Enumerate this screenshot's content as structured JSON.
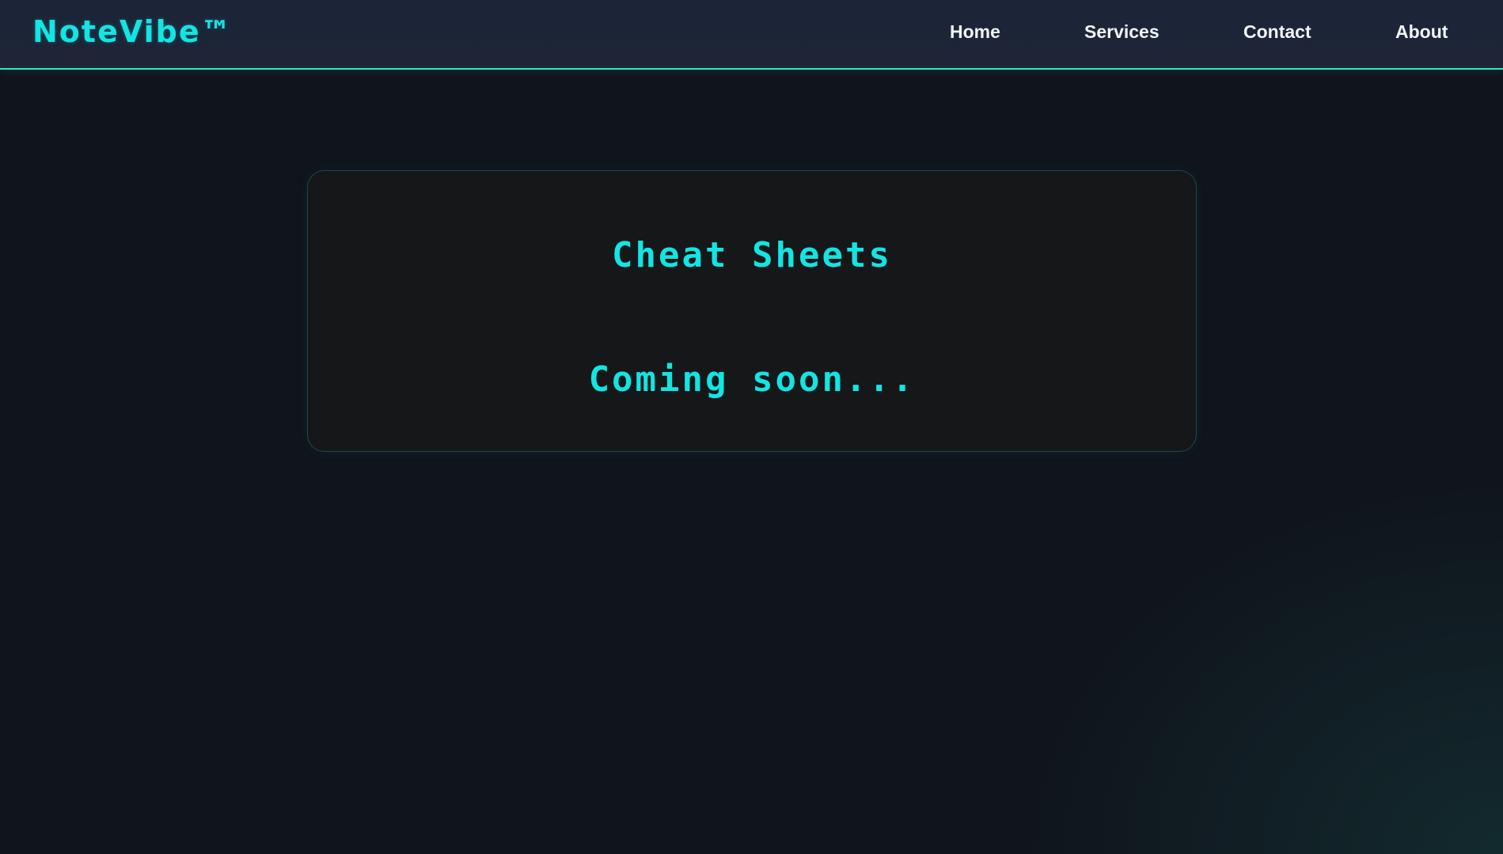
{
  "header": {
    "brand": "NoteVibe™",
    "nav": {
      "home": "Home",
      "services": "Services",
      "contact": "Contact",
      "about": "About"
    }
  },
  "main": {
    "card": {
      "title": "Cheat Sheets",
      "status": "Coming soon..."
    }
  },
  "colors": {
    "accent": "#12e5e3",
    "header_border": "#2ee6c8",
    "header_bg": "#1c2438",
    "page_bg": "#10141c",
    "card_bg": "#161719",
    "nav_text": "#f2f4f7"
  }
}
